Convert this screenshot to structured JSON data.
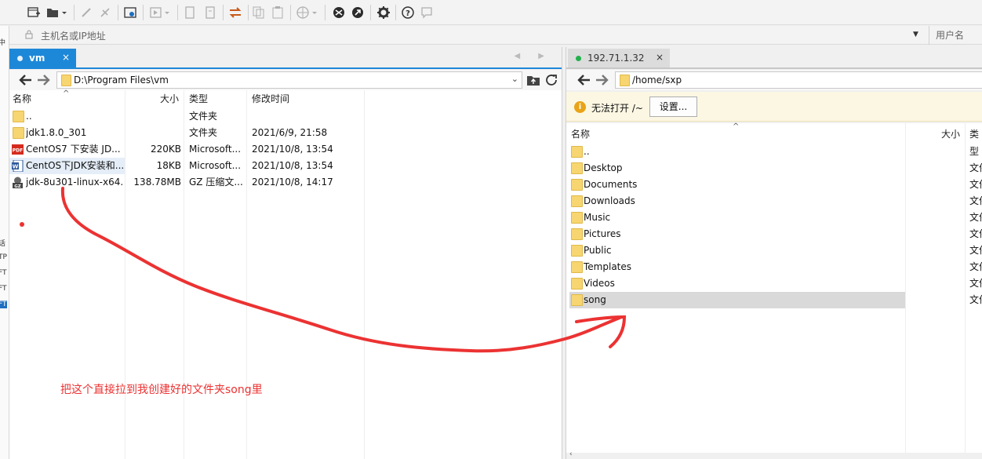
{
  "toolbar": {
    "icons": [
      "new-session-icon",
      "open-folder-icon",
      "disconnect-icon",
      "reconnect-icon",
      "session-manager-icon",
      "play-icon",
      "copy-icon",
      "paste-icon",
      "transfer-icon",
      "duplicate-icon",
      "clipboard-icon",
      "globe-icon",
      "xshell-icon",
      "xftp-icon",
      "settings-icon",
      "help-icon",
      "chat-icon"
    ]
  },
  "address": {
    "placeholder": "主机名或IP地址",
    "user_placeholder": "用户名"
  },
  "left_strip": [
    "中",
    "话",
    "TP",
    "FT",
    "FT",
    "FT",
    "FT"
  ],
  "left_pane": {
    "tab": {
      "label": "vm",
      "close": "×"
    },
    "nav": "◀ ▶",
    "path": "D:\\Program Files\\vm",
    "columns": {
      "name": "名称",
      "size": "大小",
      "type": "类型",
      "modified": "修改时间"
    },
    "rows": [
      {
        "name": "..",
        "size": "",
        "type": "文件夹",
        "modified": "",
        "icon": "folder-icon"
      },
      {
        "name": "jdk1.8.0_301",
        "size": "",
        "type": "文件夹",
        "modified": "2021/6/9, 21:58",
        "icon": "folder-icon"
      },
      {
        "name": "CentOS7 下安装 JD...",
        "size": "220KB",
        "type": "Microsoft...",
        "modified": "2021/10/8, 13:54",
        "icon": "pdf-icon"
      },
      {
        "name": "CentOS下JDK安装和...",
        "size": "18KB",
        "type": "Microsoft...",
        "modified": "2021/10/8, 13:54",
        "icon": "word-icon"
      },
      {
        "name": "jdk-8u301-linux-x64...",
        "size": "138.78MB",
        "type": "GZ 压缩文...",
        "modified": "2021/10/8, 14:17",
        "icon": "gz-icon"
      }
    ]
  },
  "right_pane": {
    "tab": {
      "label": "192.71.1.32",
      "close": "×",
      "status_color": "#22b14c"
    },
    "path": "/home/sxp",
    "warning": {
      "text": "无法打开 /~",
      "button": "设置..."
    },
    "columns": {
      "name": "名称",
      "size": "大小",
      "type": "类型"
    },
    "rows": [
      {
        "name": "..",
        "type": ""
      },
      {
        "name": "Desktop",
        "type": "文件夹"
      },
      {
        "name": "Documents",
        "type": "文件夹"
      },
      {
        "name": "Downloads",
        "type": "文件夹"
      },
      {
        "name": "Music",
        "type": "文件夹"
      },
      {
        "name": "Pictures",
        "type": "文件夹"
      },
      {
        "name": "Public",
        "type": "文件夹"
      },
      {
        "name": "Templates",
        "type": "文件夹"
      },
      {
        "name": "Videos",
        "type": "文件夹"
      },
      {
        "name": "song",
        "type": "文件夹",
        "selected": true
      }
    ]
  },
  "annotation": {
    "text": "把这个直接拉到我创建好的文件夹song里",
    "color": "#ec3232"
  },
  "colors": {
    "accent": "#1e88d8",
    "selected_row": "#d9d9d9",
    "folder": "#f7d570"
  }
}
